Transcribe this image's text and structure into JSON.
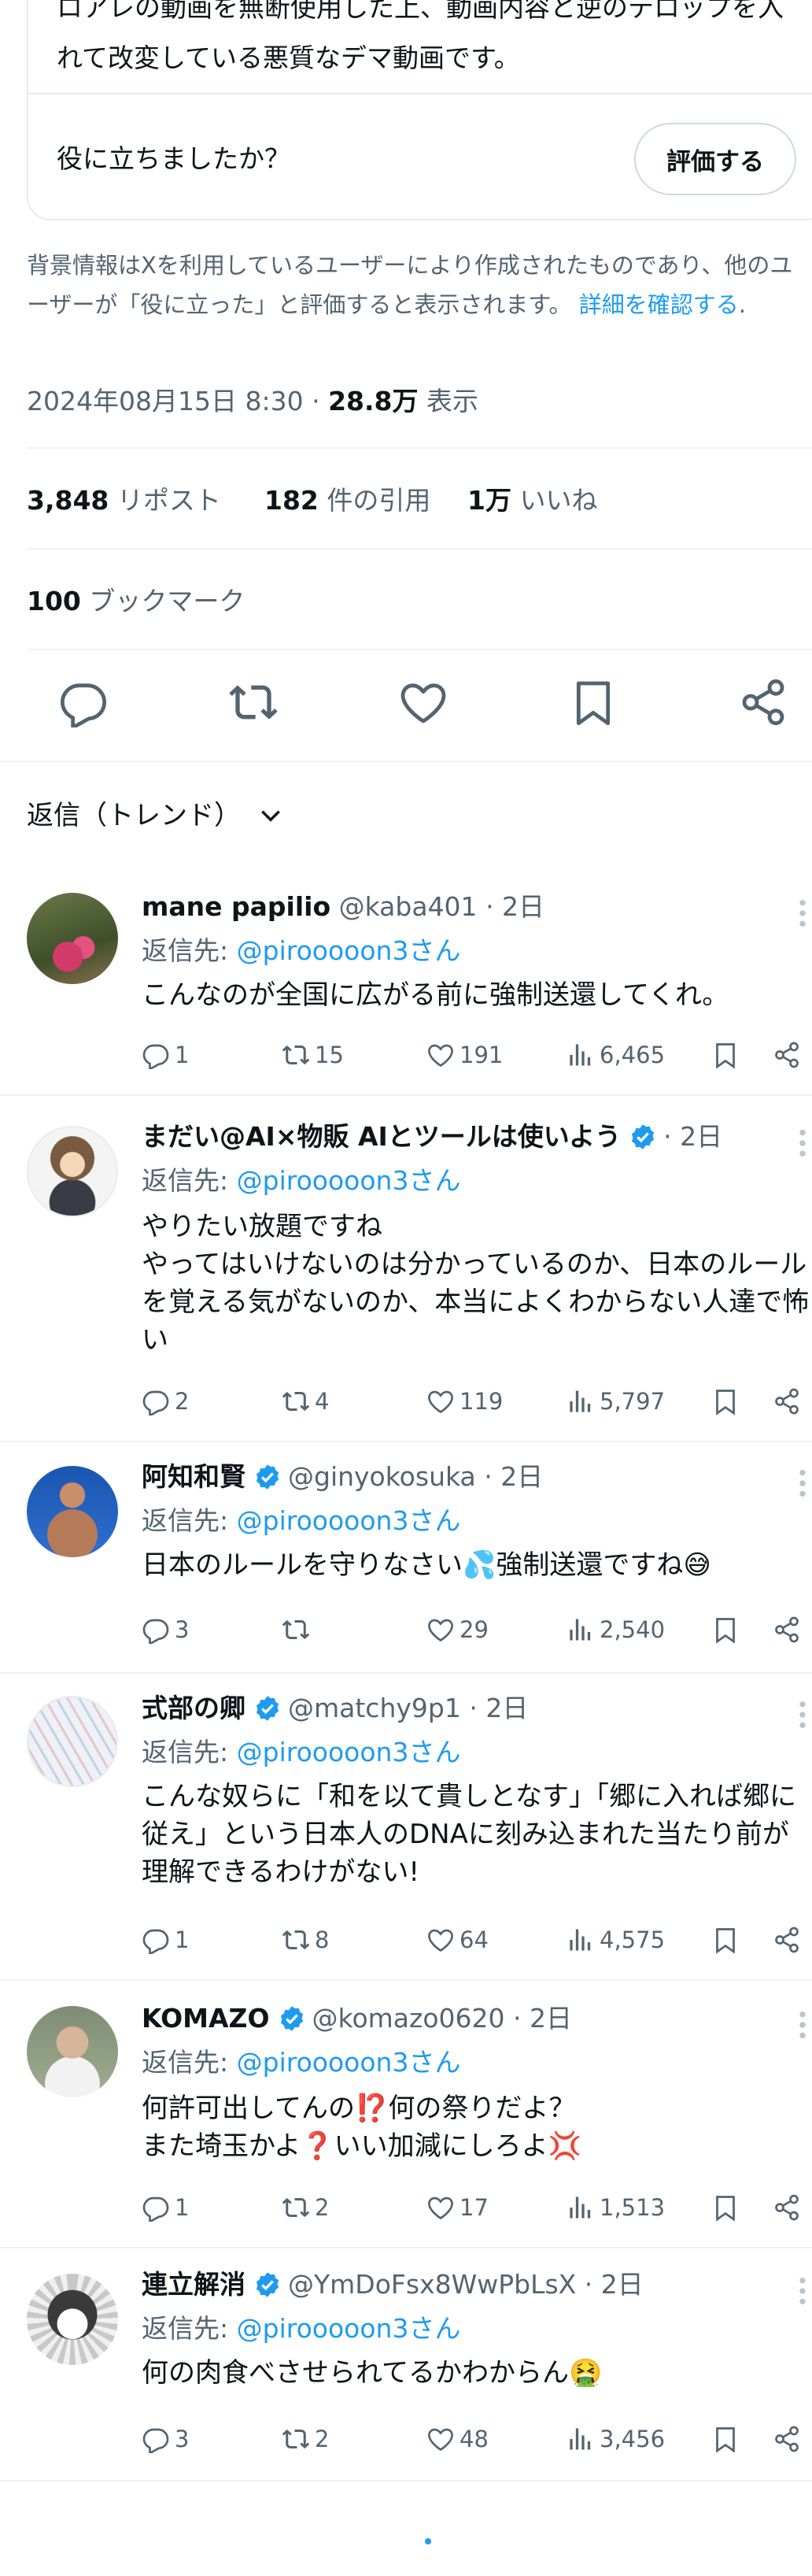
{
  "community_note": {
    "text": "ロアレの動画を無断使用した上、動画内容と逆のテロップを入れて改変している悪質なデマ動画です。",
    "helpful_question": "役に立ちましたか？",
    "rate_button": "評価する",
    "disclaimer": "背景情報はXを利用しているユーザーにより作成されたものであり、他のユーザーが「役に立った」と評価すると表示されます。",
    "learn_more": "詳細を確認する",
    "period": "."
  },
  "post_meta": {
    "datetime": "2024年08月15日 8:30",
    "separator": "·",
    "views_count": "28.8万",
    "views_label": "表示"
  },
  "stats": {
    "reposts_count": "3,848",
    "reposts_label": "リポスト",
    "quotes_count": "182",
    "quotes_label": "件の引用",
    "likes_count": "1万",
    "likes_label": "いいね",
    "bookmarks_count": "100",
    "bookmarks_label": "ブックマーク"
  },
  "replies_sort": {
    "label": "返信（トレンド）"
  },
  "reply_to_prefix": "返信先:",
  "reply_to_handle": "@piroooοon3さん",
  "replies": [
    {
      "name": "mane papilio",
      "verified": false,
      "handle": "@kaba401",
      "time": "· 2日",
      "text": "こんなのが全国に広がる前に強制送還してくれ。",
      "reply_count": "1",
      "repost_count": "15",
      "like_count": "191",
      "view_count": "6,465"
    },
    {
      "name": "まだい@AI×物販 AIとツールは使いよう",
      "verified": true,
      "handle": "",
      "time": "· 2日",
      "text": "やりたい放題ですね\nやってはいけないのは分かっているのか、日本のルールを覚える気がないのか、本当によくわからない人達で怖い",
      "reply_count": "2",
      "repost_count": "4",
      "like_count": "119",
      "view_count": "5,797"
    },
    {
      "name": "阿知和賢",
      "verified": true,
      "handle": "@ginyokosuka",
      "time": "· 2日",
      "text": "日本のルールを守りなさい💦強制送還ですね😅",
      "reply_count": "3",
      "repost_count": "",
      "like_count": "29",
      "view_count": "2,540"
    },
    {
      "name": "式部の卿",
      "verified": true,
      "handle": "@matchy9p1",
      "time": "· 2日",
      "text": "こんな奴らに「和を以て貴しとなす」「郷に入れば郷に従え」という日本人のDNAに刻み込まれた当たり前が理解できるわけがない!",
      "reply_count": "1",
      "repost_count": "8",
      "like_count": "64",
      "view_count": "4,575"
    },
    {
      "name": "KOMAZO",
      "verified": true,
      "handle": "@komazo0620",
      "time": "· 2日",
      "text": "何許可出してんの⁉️何の祭りだよ？\nまた埼玉かよ❓いい加減にしろよ💢",
      "reply_count": "1",
      "repost_count": "2",
      "like_count": "17",
      "view_count": "1,513"
    },
    {
      "name": "連立解消",
      "verified": true,
      "handle": "@YmDoFsx8WwPbLsX",
      "time": "· 2日",
      "text": "何の肉食べさせられてるかわからん🤮",
      "reply_count": "3",
      "repost_count": "2",
      "like_count": "48",
      "view_count": "3,456"
    }
  ],
  "colors": {
    "text_primary": "#0f1419",
    "text_secondary": "#536471",
    "accent": "#1d9bf0",
    "border": "#eff3f4"
  },
  "icons": [
    "reply-icon",
    "repost-icon",
    "like-icon",
    "bookmark-icon",
    "share-icon",
    "views-icon",
    "chevron-down-icon",
    "verified-badge-icon",
    "more-icon"
  ]
}
